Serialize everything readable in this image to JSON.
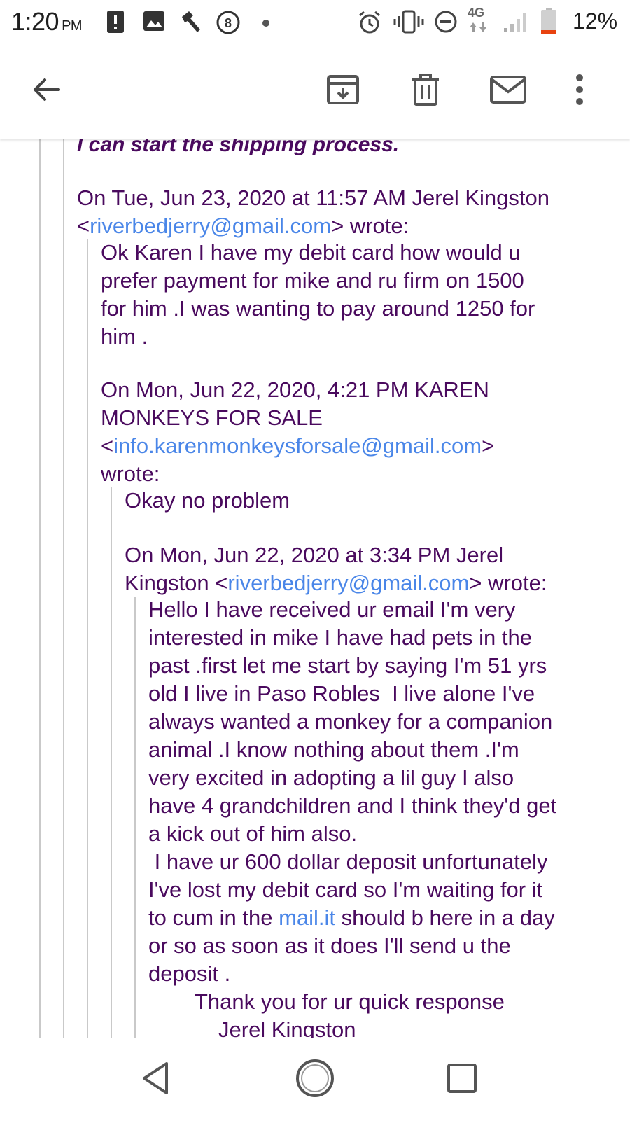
{
  "status_bar": {
    "time": "1:20",
    "ampm": "PM",
    "network": "4G",
    "battery": "12%",
    "icons": [
      "alert-icon",
      "image-icon",
      "hammer-icon",
      "circle-8-icon",
      "dot-icon",
      "alarm-icon",
      "vibrate-icon",
      "do-not-disturb-icon",
      "signal-icon",
      "battery-icon"
    ]
  },
  "toolbar": {
    "icons": [
      "back-arrow-icon",
      "archive-icon",
      "delete-icon",
      "mail-icon",
      "more-vert-icon"
    ]
  },
  "message": {
    "cut_line": "I can start the shipping process.",
    "level1": {
      "header_line1": "On Tue, Jun 23, 2020 at 11:57 AM Jerel Kingston",
      "header_open": "<",
      "header_email": "riverbedjerry@gmail.com",
      "header_close": "> wrote:",
      "body": [
        "Ok Karen I have my debit card how would u",
        "prefer payment for mike and ru firm on 1500",
        "for him .I was wanting to pay around 1250 for",
        "him ."
      ]
    },
    "level2": {
      "header_line1": "On Mon, Jun 22, 2020, 4:21 PM KAREN",
      "header_line2": "MONKEYS FOR SALE",
      "header_open": "<",
      "header_email": "info.karenmonkeysforsale@gmail.com",
      "header_close": ">",
      "header_line4": "wrote:",
      "body": "Okay no problem"
    },
    "level3": {
      "header_line1": "On Mon, Jun 22, 2020 at 3:34 PM Jerel",
      "header_pre": "Kingston <",
      "header_email": "riverbedjerry@gmail.com",
      "header_close": "> wrote:"
    },
    "level4": {
      "body": [
        "Hello I have received ur email I'm very",
        "interested in mike I have had pets in the",
        "past .first let me start by saying I'm 51 yrs",
        "old I live in Paso Robles  I live alone I've",
        "always wanted a monkey for a companion",
        "animal .I know nothing about them .I'm",
        "very excited in adopting a lil guy I also",
        "have 4 grandchildren and I think they'd get",
        "a kick out of him also.",
        " I have ur 600 dollar deposit unfortunately",
        "I've lost my debit card so I'm waiting for it"
      ],
      "link_line_pre": "to cum in the ",
      "link_text": "mail.it",
      "link_line_post": " should b here in a day",
      "body_tail": [
        "or so as soon as it does I'll send u the",
        "deposit ."
      ],
      "closing": "Thank you for ur quick response",
      "closing_cut": "Jerel Kingston"
    }
  },
  "navbar": {
    "icons": [
      "nav-back-icon",
      "nav-home-icon",
      "nav-recents-icon"
    ]
  },
  "colors": {
    "text": "#4a0a5e",
    "link": "#4a86e8",
    "quote_bar": "#c9c9c9"
  }
}
